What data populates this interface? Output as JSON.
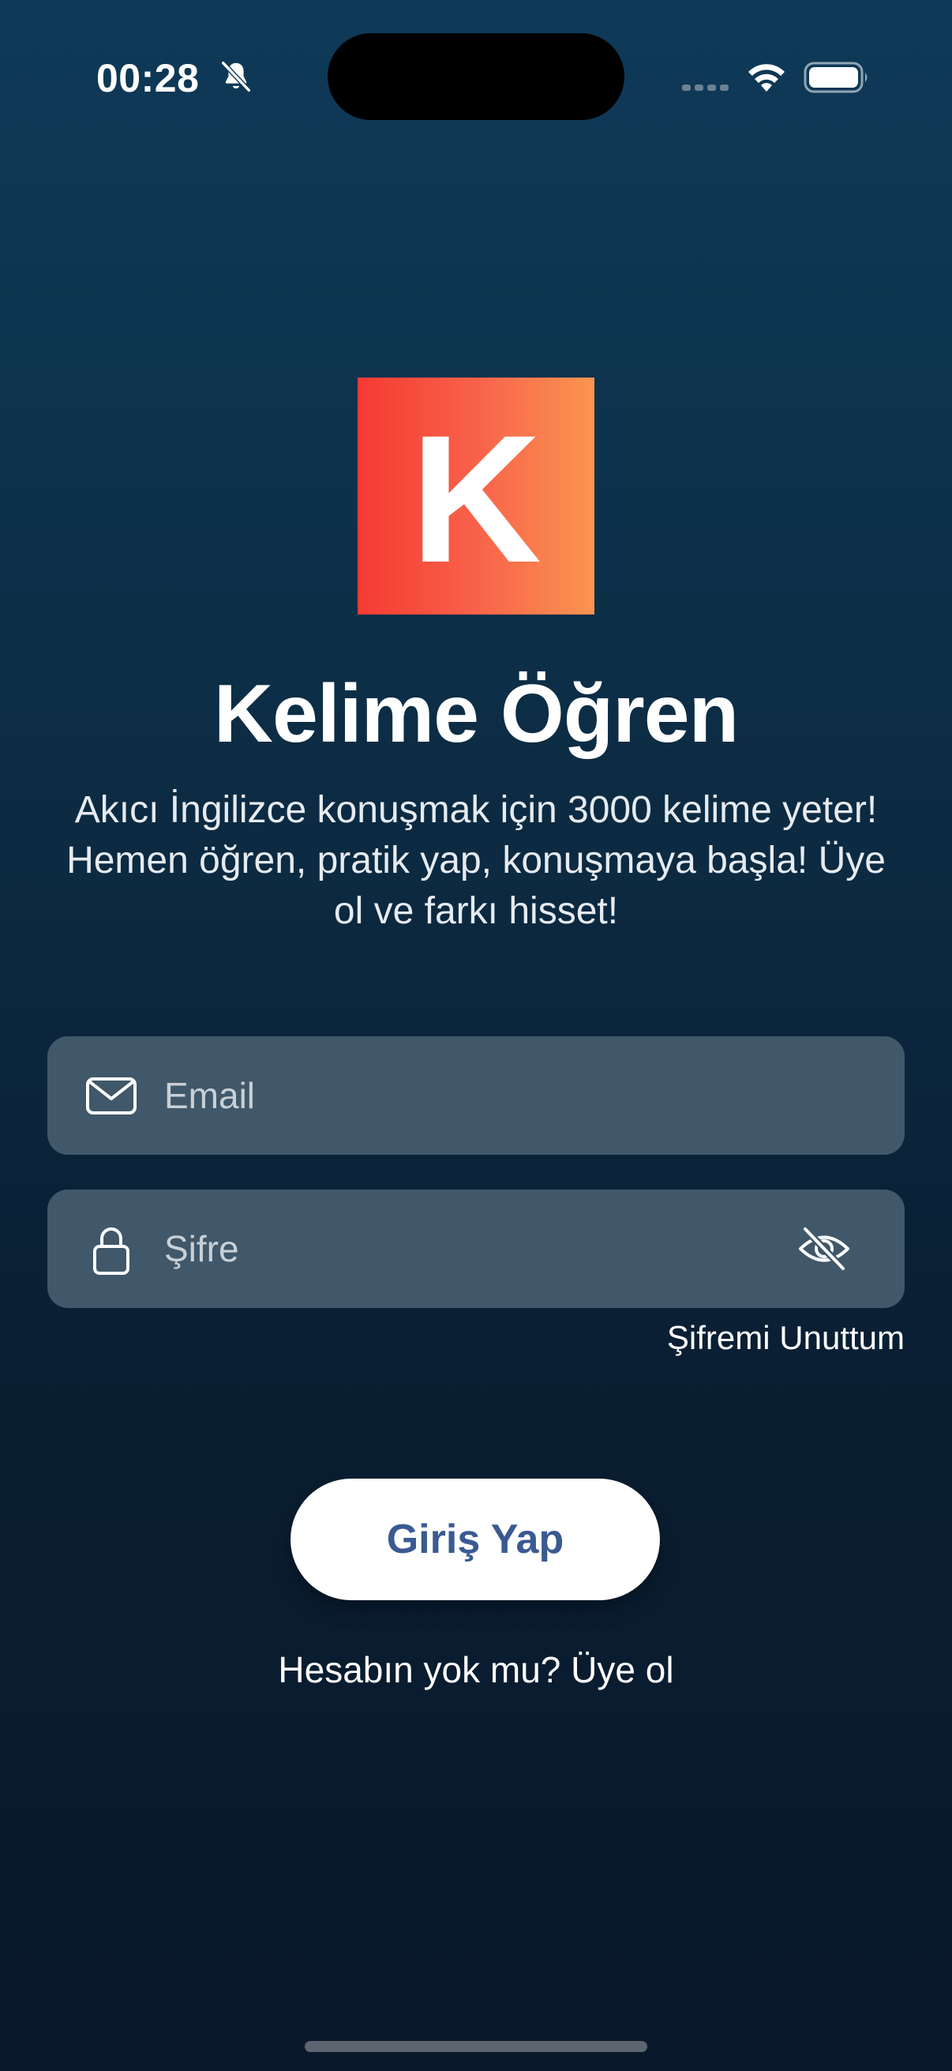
{
  "status_bar": {
    "time": "00:28",
    "icons": [
      "bell-slash-icon",
      "signal-icon",
      "wifi-icon",
      "battery-icon"
    ]
  },
  "logo": {
    "letter": "K",
    "gradient_colors": [
      "#f53a33",
      "#fa9550"
    ]
  },
  "app": {
    "title": "Kelime Öğren",
    "tagline": "Akıcı İngilizce konuşmak için 3000 kelime yeter! Hemen öğren, pratik yap, konuşmaya başla! Üye ol ve farkı hisset!"
  },
  "form": {
    "email": {
      "value": "",
      "placeholder": "Email",
      "icon": "envelope-icon"
    },
    "password": {
      "value": "",
      "placeholder": "Şifre",
      "icon": "lock-icon",
      "toggle_icon": "eye-slash-icon"
    },
    "forgot_label": "Şifremi Unuttum",
    "login_label": "Giriş Yap",
    "signup_label": "Hesabın yok mu? Üye ol"
  },
  "colors": {
    "background_top": "#0e3a58",
    "background_bottom": "#09182a",
    "field_background": "#405869",
    "button_text": "#3a5a92"
  }
}
